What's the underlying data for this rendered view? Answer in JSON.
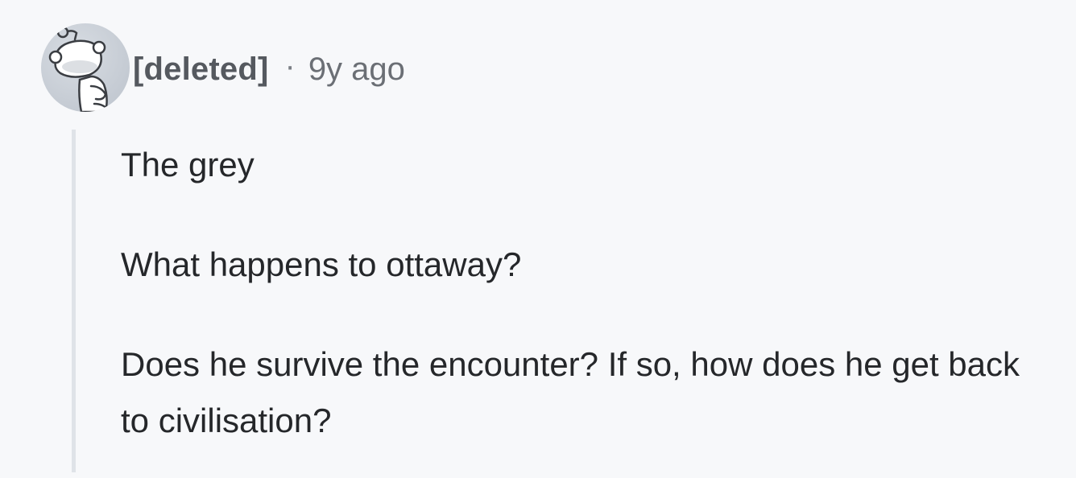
{
  "comment": {
    "author": "[deleted]",
    "separator": "·",
    "timestamp": "9y ago",
    "avatar_icon": "snoo-deleted-avatar-icon",
    "paragraphs": [
      "The grey",
      "What happens to ottaway?",
      "Does he survive the encounter? If so, how does he get back to civilisation?"
    ]
  },
  "colors": {
    "background": "#f7f8fa",
    "thread_line": "#dfe3e8",
    "author_text": "#55595f",
    "body_text": "#25272a"
  }
}
